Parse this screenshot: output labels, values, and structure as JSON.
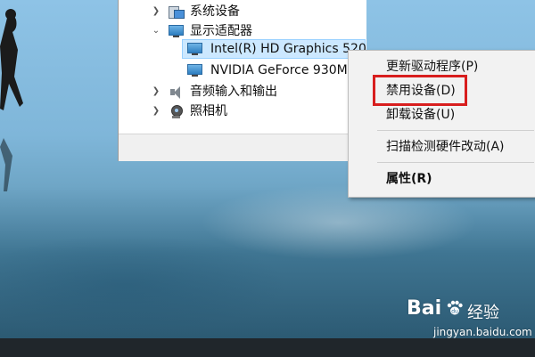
{
  "colors": {
    "selection": "#cce8ff",
    "highlight_box": "#d81e1e",
    "menu_bg": "#f2f2f2",
    "taskbar": "#20262b"
  },
  "tree": {
    "system_devices": {
      "label": "系统设备",
      "icon": "devices-icon",
      "state": "collapsed"
    },
    "display_adapters": {
      "label": "显示适配器",
      "icon": "monitor-icon",
      "state": "expanded"
    },
    "intel_adapter": {
      "label": "Intel(R) HD Graphics 520",
      "icon": "monitor-icon",
      "selected": true
    },
    "nvidia_adapter": {
      "label": "NVIDIA GeForce 930M",
      "icon": "monitor-icon"
    },
    "audio": {
      "label": "音频输入和输出",
      "icon": "speaker-icon",
      "state": "collapsed"
    },
    "camera": {
      "label": "照相机",
      "icon": "camera-icon",
      "state": "collapsed"
    }
  },
  "context_menu": {
    "items": [
      {
        "label": "更新驱动程序(P)"
      },
      {
        "label": "禁用设备(D)",
        "highlighted": true
      },
      {
        "label": "卸载设备(U)"
      },
      {
        "label": "扫描检测硬件改动(A)"
      },
      {
        "label": "属性(R)",
        "bold": true
      }
    ]
  },
  "watermark": {
    "logo": "Bai",
    "logo_suffix": "经验",
    "url": "jingyan.baidu.com"
  }
}
